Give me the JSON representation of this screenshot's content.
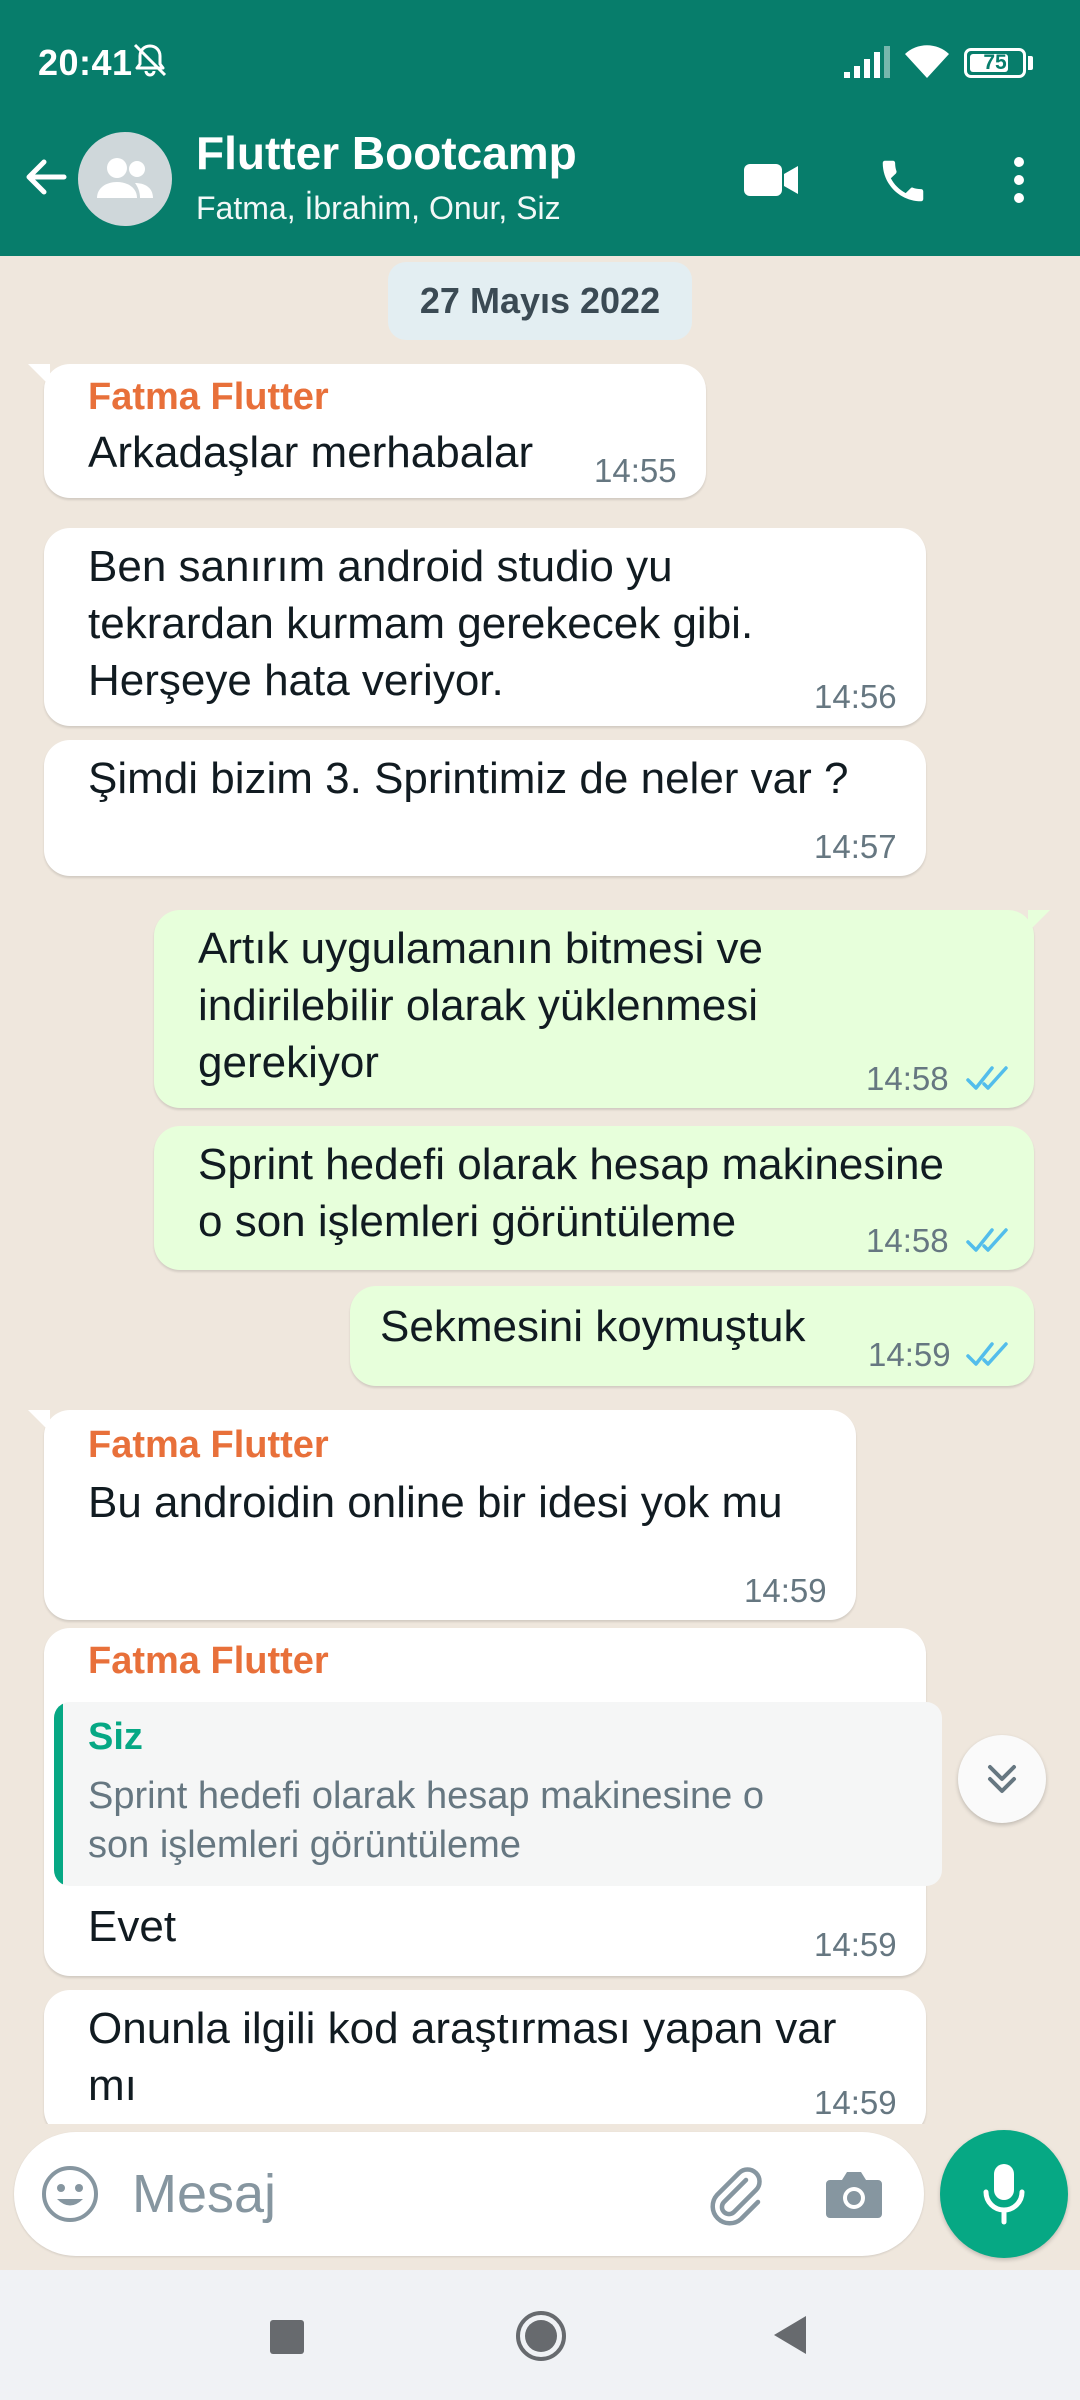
{
  "status_bar": {
    "time": "20:41",
    "battery": "75",
    "battery_level": 0.75
  },
  "header": {
    "title": "Flutter Bootcamp",
    "subtitle": "Fatma, İbrahim, Onur, Siz"
  },
  "chat": {
    "date_chip": "27 Mayıs 2022",
    "messages": [
      {
        "sender": "Fatma Flutter",
        "lines": [
          "Arkadaşlar merhabalar"
        ],
        "time": "14:55"
      },
      {
        "lines": [
          "Ben sanırım android studio yu",
          "tekrardan kurmam gerekecek gibi.",
          "Herşeye hata veriyor."
        ],
        "time": "14:56"
      },
      {
        "lines": [
          "Şimdi bizim 3. Sprintimiz de neler var ?"
        ],
        "time": "14:57"
      },
      {
        "lines": [
          "Artık uygulamanın bitmesi ve",
          "indirilebilir olarak yüklenmesi",
          "gerekiyor"
        ],
        "time": "14:58",
        "status": "read"
      },
      {
        "lines": [
          "Sprint hedefi olarak hesap makinesine",
          "o son işlemleri görüntüleme"
        ],
        "time": "14:58",
        "status": "read"
      },
      {
        "lines": [
          "Sekmesini koymuştuk"
        ],
        "time": "14:59",
        "status": "read"
      },
      {
        "sender": "Fatma Flutter",
        "lines": [
          "Bu androidin online bir idesi yok mu"
        ],
        "time": "14:59"
      },
      {
        "sender": "Fatma Flutter",
        "quote": {
          "name": "Siz",
          "lines": [
            "Sprint hedefi olarak hesap makinesine o",
            "son işlemleri görüntüleme"
          ]
        },
        "lines": [
          "Evet"
        ],
        "time": "14:59"
      },
      {
        "lines": [
          "Onunla ilgili kod araştırması yapan var",
          "mı"
        ],
        "time": "14:59"
      }
    ]
  },
  "composer": {
    "placeholder": "Mesaj"
  },
  "colors": {
    "header": "#077d6b",
    "accent": "#06a884",
    "sender_name": "#e8703a",
    "outgoing_bubble": "#e7ffdb",
    "read_ticks": "#53bdeb"
  },
  "icons": [
    "bell-off-icon",
    "signal-icon",
    "wifi-icon",
    "battery-icon",
    "back-arrow-icon",
    "group-icon",
    "video-call-icon",
    "phone-icon",
    "more-vert-icon",
    "double-check-icon",
    "chevron-double-down-icon",
    "emoji-icon",
    "paperclip-icon",
    "camera-icon",
    "mic-icon"
  ]
}
